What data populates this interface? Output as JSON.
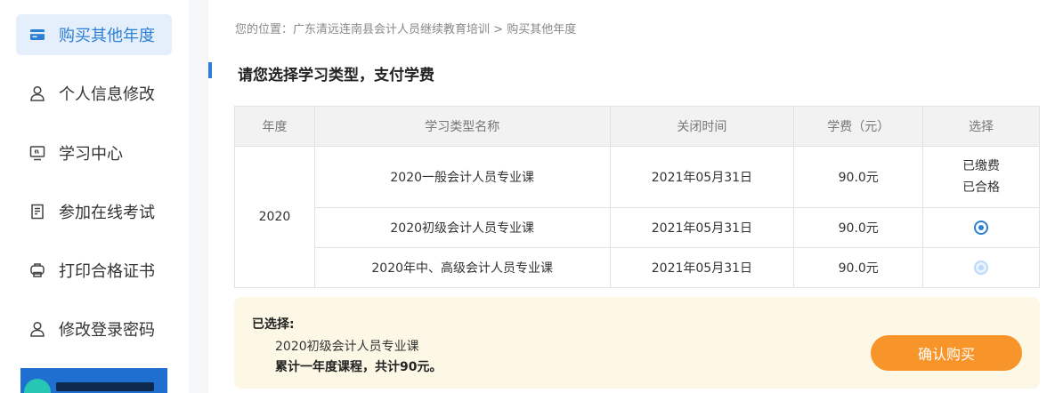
{
  "sidebar": {
    "items": [
      {
        "label": "购买其他年度",
        "icon": "card-icon",
        "active": true
      },
      {
        "label": "个人信息修改",
        "icon": "user-icon",
        "active": false
      },
      {
        "label": "学习中心",
        "icon": "monitor-icon",
        "active": false
      },
      {
        "label": "参加在线考试",
        "icon": "exam-doc-icon",
        "active": false
      },
      {
        "label": "打印合格证书",
        "icon": "printer-icon",
        "active": false
      },
      {
        "label": "修改登录密码",
        "icon": "user-lock-icon",
        "active": false
      }
    ]
  },
  "breadcrumb": {
    "prefix": "您的位置：",
    "path": "广东清远连南县会计人员继续教育培训",
    "separator": " > ",
    "current": "购买其他年度"
  },
  "section": {
    "title": "请您选择学习类型，支付学费"
  },
  "table": {
    "headers": [
      "年度",
      "学习类型名称",
      "关闭时间",
      "学费（元）",
      "选择"
    ],
    "year": "2020",
    "rows": [
      {
        "name": "2020一般会计人员专业课",
        "close_time": "2021年05月31日",
        "fee": "90.0元",
        "status_line1": "已缴费",
        "status_line2": "已合格",
        "selection": "paid"
      },
      {
        "name": "2020初级会计人员专业课",
        "close_time": "2021年05月31日",
        "fee": "90.0元",
        "selection": "selected"
      },
      {
        "name": "2020年中、高级会计人员专业课",
        "close_time": "2021年05月31日",
        "fee": "90.0元",
        "selection": "disabled"
      }
    ]
  },
  "summary": {
    "label": "已选择:",
    "course": "2020初级会计人员专业课",
    "total": "累计一年度课程，共计90元。",
    "confirm_label": "确认购买"
  },
  "colors": {
    "accent": "#2d7fd6",
    "active_bg": "#e4effb",
    "confirm": "#f7952a",
    "summary_bg": "#fdf8e6"
  }
}
